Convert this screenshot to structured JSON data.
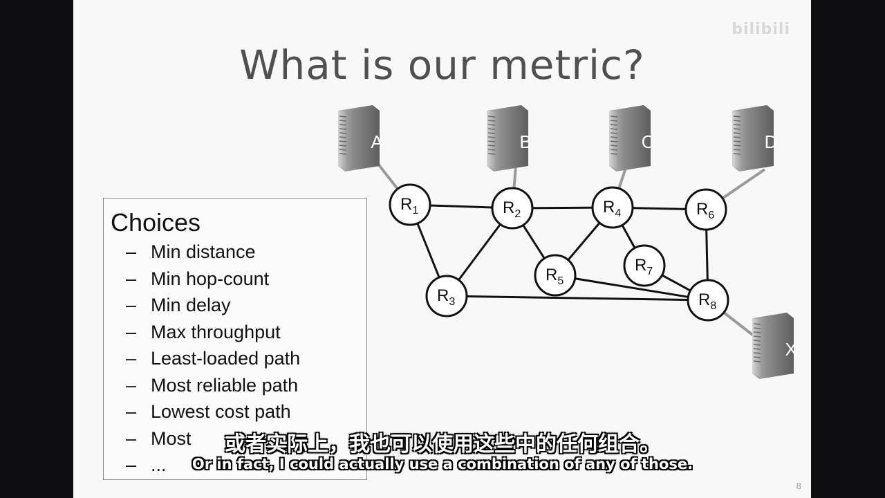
{
  "watermark": "bilibili",
  "title": "What is our metric?",
  "choices": {
    "heading": "Choices",
    "dash": "–",
    "items": [
      "Min distance",
      "Min hop-count",
      "Min delay",
      "Max throughput",
      "Least-loaded path",
      "Most reliable path",
      "Lowest cost path",
      "Most",
      "..."
    ]
  },
  "diagram": {
    "hosts": [
      {
        "id": "A",
        "label": "A"
      },
      {
        "id": "B",
        "label": "B"
      },
      {
        "id": "C",
        "label": "C"
      },
      {
        "id": "D",
        "label": "D"
      },
      {
        "id": "X",
        "label": "X"
      }
    ],
    "routers": [
      {
        "id": "R1",
        "letter": "R",
        "sub": "1"
      },
      {
        "id": "R2",
        "letter": "R",
        "sub": "2"
      },
      {
        "id": "R3",
        "letter": "R",
        "sub": "3"
      },
      {
        "id": "R4",
        "letter": "R",
        "sub": "4"
      },
      {
        "id": "R5",
        "letter": "R",
        "sub": "5"
      },
      {
        "id": "R6",
        "letter": "R",
        "sub": "6"
      },
      {
        "id": "R7",
        "letter": "R",
        "sub": "7"
      },
      {
        "id": "R8",
        "letter": "R",
        "sub": "8"
      }
    ],
    "router_links": [
      [
        "R1",
        "R2"
      ],
      [
        "R1",
        "R3"
      ],
      [
        "R2",
        "R3"
      ],
      [
        "R2",
        "R4"
      ],
      [
        "R2",
        "R5"
      ],
      [
        "R4",
        "R5"
      ],
      [
        "R4",
        "R6"
      ],
      [
        "R4",
        "R7"
      ],
      [
        "R6",
        "R8"
      ],
      [
        "R7",
        "R8"
      ],
      [
        "R5",
        "R8"
      ],
      [
        "R3",
        "R8"
      ]
    ],
    "host_links": [
      [
        "A",
        "R1"
      ],
      [
        "B",
        "R2"
      ],
      [
        "C",
        "R4"
      ],
      [
        "D",
        "R6"
      ],
      [
        "X",
        "R8"
      ]
    ]
  },
  "page_number": "8",
  "subtitles": {
    "zh": "或者实际上，我也可以使用这些中的任何组合。",
    "en": "Or in fact, I could actually use a combination of any of those."
  },
  "colors": {
    "slide_bg": "#f8f8f8",
    "title": "#505050",
    "router_stroke": "#111111",
    "host_link": "#9a9a9a"
  }
}
